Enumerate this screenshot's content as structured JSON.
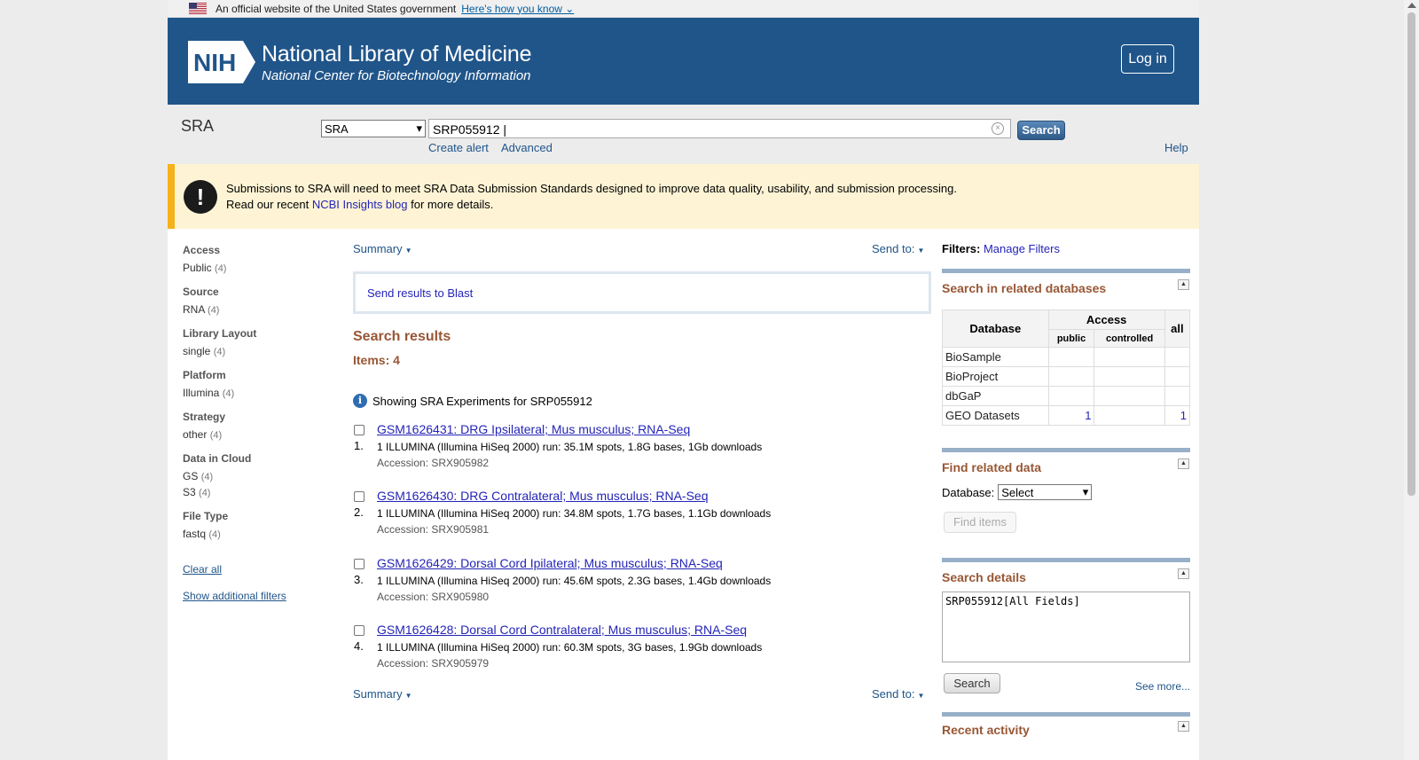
{
  "gov_banner": {
    "text": "An official website of the United States government",
    "link": "Here's how you know"
  },
  "header": {
    "logo_text": "NIH",
    "title": "National Library of Medicine",
    "subtitle": "National Center for Biotechnology Information",
    "login_label": "Log in",
    "brand_color": "#20558a"
  },
  "searchbar": {
    "db_label": "SRA",
    "db_selected": "SRA",
    "query": "SRP055912",
    "search_label": "Search",
    "create_alert": "Create alert",
    "advanced": "Advanced",
    "help": "Help"
  },
  "alert": {
    "line1": "Submissions to SRA will need to meet SRA Data Submission Standards designed to improve data quality, usability, and submission processing.",
    "line2_pre": "Read our recent ",
    "line2_link": "NCBI Insights blog",
    "line2_post": " for more details."
  },
  "facets": [
    {
      "title": "Access",
      "items": [
        {
          "label": "Public",
          "count": "(4)"
        }
      ]
    },
    {
      "title": "Source",
      "items": [
        {
          "label": "RNA",
          "count": "(4)"
        }
      ]
    },
    {
      "title": "Library Layout",
      "items": [
        {
          "label": "single",
          "count": "(4)"
        }
      ]
    },
    {
      "title": "Platform",
      "items": [
        {
          "label": "Illumina",
          "count": "(4)"
        }
      ]
    },
    {
      "title": "Strategy",
      "items": [
        {
          "label": "other",
          "count": "(4)"
        }
      ]
    },
    {
      "title": "Data in Cloud",
      "items": [
        {
          "label": "GS",
          "count": "(4)"
        },
        {
          "label": "S3",
          "count": "(4)"
        }
      ]
    },
    {
      "title": "File Type",
      "items": [
        {
          "label": "fastq",
          "count": "(4)"
        }
      ]
    }
  ],
  "facet_links": {
    "clear_all": "Clear all",
    "show_additional": "Show additional filters"
  },
  "center": {
    "summary_label": "Summary",
    "send_to_label": "Send to:",
    "blast_link": "Send results to Blast",
    "results_title": "Search results",
    "items_count": "Items: 4",
    "info_text": "Showing SRA Experiments for SRP055912",
    "results": [
      {
        "num": "1.",
        "title": "GSM1626431: DRG Ipsilateral; Mus musculus; RNA-Seq",
        "desc": "1 ILLUMINA (Illumina HiSeq 2000) run: 35.1M spots, 1.8G bases, 1Gb downloads",
        "accession": "Accession: SRX905982"
      },
      {
        "num": "2.",
        "title": "GSM1626430: DRG Contralateral; Mus musculus; RNA-Seq",
        "desc": "1 ILLUMINA (Illumina HiSeq 2000) run: 34.8M spots, 1.7G bases, 1.1Gb downloads",
        "accession": "Accession: SRX905981"
      },
      {
        "num": "3.",
        "title": "GSM1626429: Dorsal Cord Ipilateral; Mus musculus; RNA-Seq",
        "desc": "1 ILLUMINA (Illumina HiSeq 2000) run: 45.6M spots, 2.3G bases, 1.4Gb downloads",
        "accession": "Accession: SRX905980"
      },
      {
        "num": "4.",
        "title": "GSM1626428: Dorsal Cord Contralateral; Mus musculus; RNA-Seq",
        "desc": "1 ILLUMINA (Illumina HiSeq 2000) run: 60.3M spots, 3G bases, 1.9Gb downloads",
        "accession": "Accession: SRX905979"
      }
    ]
  },
  "right": {
    "filters_label": "Filters:",
    "manage_filters": "Manage Filters",
    "related_title": "Search in related databases",
    "table": {
      "col_database": "Database",
      "col_access": "Access",
      "col_all": "all",
      "col_public": "public",
      "col_controlled": "controlled",
      "rows": [
        {
          "db": "BioSample",
          "public": "",
          "controlled": "",
          "all": ""
        },
        {
          "db": "BioProject",
          "public": "",
          "controlled": "",
          "all": ""
        },
        {
          "db": "dbGaP",
          "public": "",
          "controlled": "",
          "all": ""
        },
        {
          "db": "GEO Datasets",
          "public": "1",
          "controlled": "",
          "all": "1"
        }
      ]
    },
    "find_title": "Find related data",
    "database_label": "Database:",
    "database_selected": "Select",
    "find_items": "Find items",
    "details_title": "Search details",
    "details_query": "SRP055912[All Fields]",
    "details_search": "Search",
    "see_more": "See more...",
    "recent_title": "Recent activity"
  }
}
